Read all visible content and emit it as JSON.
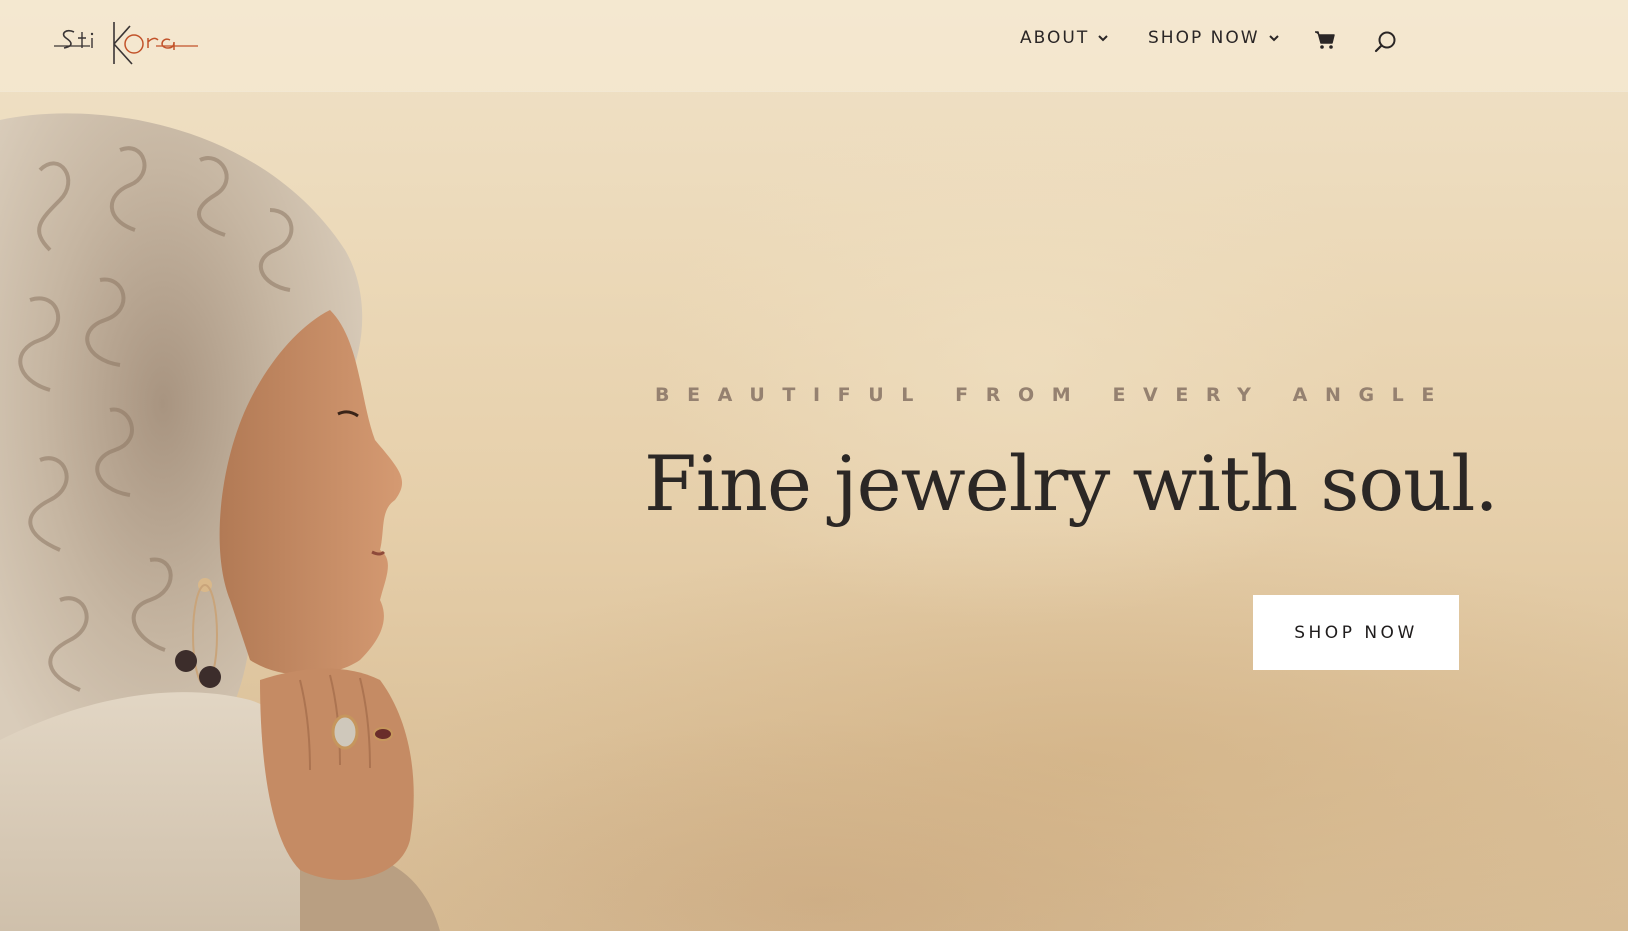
{
  "brand": {
    "logo_text": "StiKOra",
    "logo_name": "stikora-logo"
  },
  "nav": {
    "items": [
      {
        "label": "ABOUT",
        "icon": "chevron-down-icon"
      },
      {
        "label": "SHOP NOW",
        "icon": "chevron-down-icon"
      }
    ],
    "cart_icon": "shopping-cart-icon",
    "search_icon": "search-icon"
  },
  "hero": {
    "tagline": "BEAUTIFUL FROM EVERY ANGLE",
    "headline": "Fine jewelry with soul.",
    "cta_label": "SHOP NOW"
  },
  "colors": {
    "background": "#ead8bb",
    "header_overlay": "#f7ecd7",
    "tagline": "#958170",
    "headline": "#2b2725",
    "nav_text": "#2a2626",
    "logo_accent": "#c2532a",
    "button_bg": "#ffffff"
  }
}
